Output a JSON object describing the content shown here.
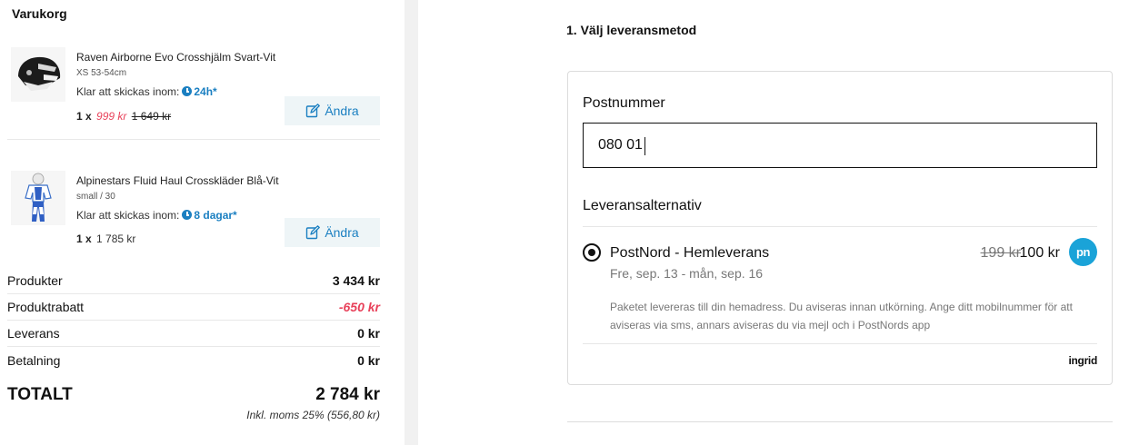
{
  "cart": {
    "title": "Varukorg",
    "items": [
      {
        "name": "Raven Airborne Evo Crosshjälm Svart-Vit",
        "variant": "XS 53-54cm",
        "ship_prefix": "Klar att skickas inom:",
        "ship_time": "24h*",
        "qty": "1 x",
        "price": "999 kr",
        "old_price": "1 649 kr",
        "edit_label": "Ändra"
      },
      {
        "name": "Alpinestars Fluid Haul Crosskläder Blå-Vit",
        "variant": "small / 30",
        "ship_prefix": "Klar att skickas inom:",
        "ship_time": "8 dagar*",
        "qty": "1 x",
        "price": "1 785 kr",
        "edit_label": "Ändra"
      }
    ],
    "summary": [
      {
        "label": "Produkter",
        "value": "3 434 kr"
      },
      {
        "label": "Produktrabatt",
        "value": "-650 kr"
      },
      {
        "label": "Leverans",
        "value": "0 kr"
      },
      {
        "label": "Betalning",
        "value": "0 kr"
      }
    ],
    "total_label": "TOTALT",
    "total_value": "2 784 kr",
    "vat_note": "Inkl. moms 25% (556,80 kr)"
  },
  "delivery": {
    "step_title": "1. Välj leveransmetod",
    "postal_label": "Postnummer",
    "postal_value": "080 01",
    "alternatives_label": "Leveransalternativ",
    "option": {
      "name": "PostNord - Hemleverans",
      "date": "Fre, sep. 13 - mån, sep. 16",
      "old_price": "199 kr",
      "price": "100 kr",
      "logo_text": "pn",
      "description": "Paketet levereras till din hemadress. Du aviseras innan utkörning. Ange ditt mobilnummer för att aviseras via sms, annars aviseras du via mejl och i PostNords app",
      "selected": true
    },
    "provider": "ingrid"
  },
  "colors": {
    "accent": "#1a7fc1",
    "sale": "#e8415a",
    "postnord": "#1aa3d8",
    "button_bg": "#eef5f7"
  }
}
